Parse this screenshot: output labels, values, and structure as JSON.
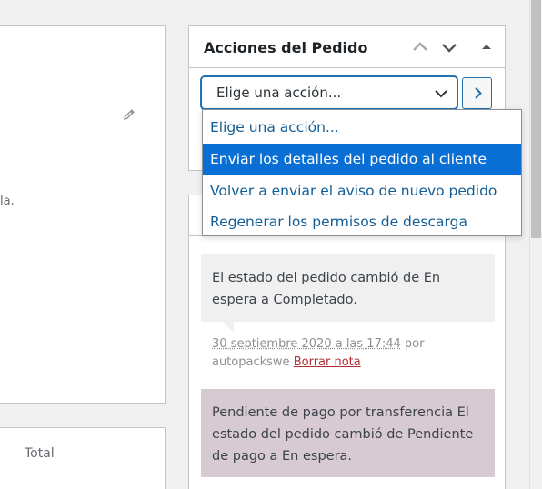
{
  "left": {
    "truncated_text": "la.",
    "total_label": "Total"
  },
  "actions": {
    "title": "Acciones del Pedido",
    "select_value": "Elige una acción...",
    "options": [
      "Elige una acción...",
      "Enviar los detalles del pedido al cliente",
      "Volver a enviar el aviso de nuevo pedido",
      "Regenerar los permisos de descarga"
    ],
    "selected_index": 1
  },
  "notes": [
    {
      "text": "El estado del pedido cambió de En espera a Completado.",
      "date": "30 septiembre 2020 a las 17:44",
      "by": "por",
      "author": "autopackswe",
      "delete_label": "Borrar nota"
    },
    {
      "text": "Pendiente de pago por transferencia El estado del pedido cambió de Pendiente de pago a En espera."
    }
  ],
  "colors": {
    "accent": "#2271b1",
    "option_highlight": "#0a6fd4",
    "customer_note_bg": "#d7cad2",
    "system_note_bg": "#f0f0f1",
    "delete_link": "#b32d2e"
  }
}
